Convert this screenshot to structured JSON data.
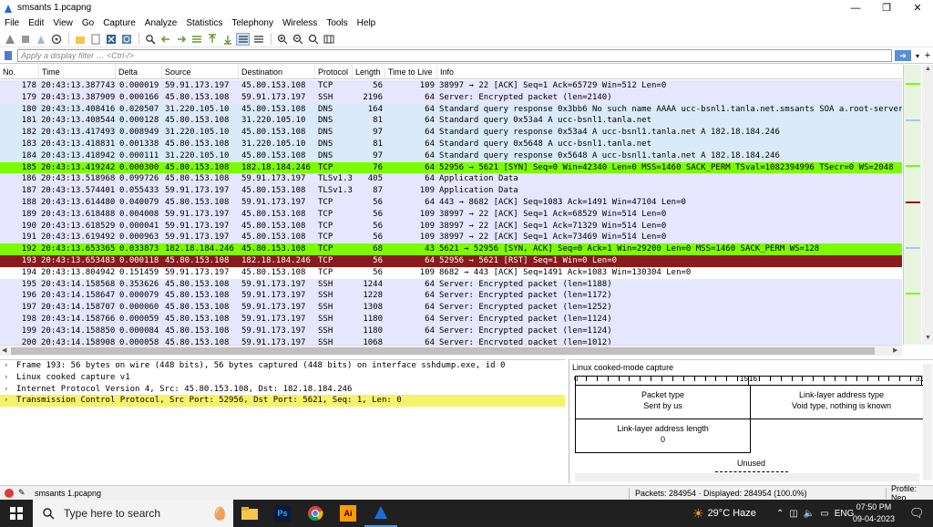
{
  "window": {
    "title": "smsants 1.pcapng",
    "minimize": "—",
    "maximize": "❐",
    "close": "✕"
  },
  "menu": [
    "File",
    "Edit",
    "View",
    "Go",
    "Capture",
    "Analyze",
    "Statistics",
    "Telephony",
    "Wireless",
    "Tools",
    "Help"
  ],
  "filter": {
    "placeholder": "Apply a display filter … <Ctrl-/>",
    "apply_icon": "arrow-right-icon"
  },
  "columns": [
    "No.",
    "Time",
    "Delta",
    "Source",
    "Destination",
    "Protocol",
    "Length",
    "Time to Live",
    "Info"
  ],
  "packets": [
    {
      "no": "178",
      "time": "20:43:13.387743",
      "delta": "0.000019",
      "src": "59.91.173.197",
      "dst": "45.80.153.108",
      "proto": "TCP",
      "len": "56",
      "ttl": "109",
      "info": "38997 → 22 [ACK] Seq=1 Ack=65729 Win=512 Len=0",
      "style": "blue"
    },
    {
      "no": "179",
      "time": "20:43:13.387909",
      "delta": "0.000166",
      "src": "45.80.153.108",
      "dst": "59.91.173.197",
      "proto": "SSH",
      "len": "2196",
      "ttl": "64",
      "info": "Server: Encrypted packet (len=2140)",
      "style": "blue"
    },
    {
      "no": "180",
      "time": "20:43:13.408416",
      "delta": "0.020507",
      "src": "31.220.105.10",
      "dst": "45.80.153.108",
      "proto": "DNS",
      "len": "164",
      "ttl": "64",
      "info": "Standard query response 0x3bb6 No such name AAAA ucc-bsnl1.tanla.net.smsants SOA a.root-servers.",
      "style": "lblue"
    },
    {
      "no": "181",
      "time": "20:43:13.408544",
      "delta": "0.000128",
      "src": "45.80.153.108",
      "dst": "31.220.105.10",
      "proto": "DNS",
      "len": "81",
      "ttl": "64",
      "info": "Standard query 0x53a4 A ucc-bsnl1.tanla.net",
      "style": "lblue"
    },
    {
      "no": "182",
      "time": "20:43:13.417493",
      "delta": "0.008949",
      "src": "31.220.105.10",
      "dst": "45.80.153.108",
      "proto": "DNS",
      "len": "97",
      "ttl": "64",
      "info": "Standard query response 0x53a4 A ucc-bsnl1.tanla.net A 182.18.184.246",
      "style": "lblue"
    },
    {
      "no": "183",
      "time": "20:43:13.418831",
      "delta": "0.001338",
      "src": "45.80.153.108",
      "dst": "31.220.105.10",
      "proto": "DNS",
      "len": "81",
      "ttl": "64",
      "info": "Standard query 0x5648 A ucc-bsnl1.tanla.net",
      "style": "lblue"
    },
    {
      "no": "184",
      "time": "20:43:13.418942",
      "delta": "0.000111",
      "src": "31.220.105.10",
      "dst": "45.80.153.108",
      "proto": "DNS",
      "len": "97",
      "ttl": "64",
      "info": "Standard query response 0x5648 A ucc-bsnl1.tanla.net A 182.18.184.246",
      "style": "lblue"
    },
    {
      "no": "185",
      "time": "20:43:13.419242",
      "delta": "0.000300",
      "src": "45.80.153.108",
      "dst": "182.18.184.246",
      "proto": "TCP",
      "len": "76",
      "ttl": "64",
      "info": "52956 → 5621 [SYN] Seq=0 Win=42340 Len=0 MSS=1460 SACK_PERM TSval=1082394996 TSecr=0 WS=2048",
      "style": "green"
    },
    {
      "no": "186",
      "time": "20:43:13.518968",
      "delta": "0.099726",
      "src": "45.80.153.108",
      "dst": "59.91.173.197",
      "proto": "TLSv1.3",
      "len": "405",
      "ttl": "64",
      "info": "Application Data",
      "style": "blue"
    },
    {
      "no": "187",
      "time": "20:43:13.574401",
      "delta": "0.055433",
      "src": "59.91.173.197",
      "dst": "45.80.153.108",
      "proto": "TLSv1.3",
      "len": "87",
      "ttl": "109",
      "info": "Application Data",
      "style": "blue"
    },
    {
      "no": "188",
      "time": "20:43:13.614480",
      "delta": "0.040079",
      "src": "45.80.153.108",
      "dst": "59.91.173.197",
      "proto": "TCP",
      "len": "56",
      "ttl": "64",
      "info": "443 → 8682 [ACK] Seq=1083 Ack=1491 Win=47104 Len=0",
      "style": "blue"
    },
    {
      "no": "189",
      "time": "20:43:13.618488",
      "delta": "0.004008",
      "src": "59.91.173.197",
      "dst": "45.80.153.108",
      "proto": "TCP",
      "len": "56",
      "ttl": "109",
      "info": "38997 → 22 [ACK] Seq=1 Ack=68529 Win=514 Len=0",
      "style": "blue"
    },
    {
      "no": "190",
      "time": "20:43:13.618529",
      "delta": "0.000041",
      "src": "59.91.173.197",
      "dst": "45.80.153.108",
      "proto": "TCP",
      "len": "56",
      "ttl": "109",
      "info": "38997 → 22 [ACK] Seq=1 Ack=71329 Win=514 Len=0",
      "style": "blue"
    },
    {
      "no": "191",
      "time": "20:43:13.619492",
      "delta": "0.000963",
      "src": "59.91.173.197",
      "dst": "45.80.153.108",
      "proto": "TCP",
      "len": "56",
      "ttl": "109",
      "info": "38997 → 22 [ACK] Seq=1 Ack=73469 Win=514 Len=0",
      "style": "blue"
    },
    {
      "no": "192",
      "time": "20:43:13.653365",
      "delta": "0.033873",
      "src": "182.18.184.246",
      "dst": "45.80.153.108",
      "proto": "TCP",
      "len": "68",
      "ttl": "43",
      "info": "5621 → 52956 [SYN, ACK] Seq=0 Ack=1 Win=29200 Len=0 MSS=1460 SACK_PERM WS=128",
      "style": "green"
    },
    {
      "no": "193",
      "time": "20:43:13.653483",
      "delta": "0.000118",
      "src": "45.80.153.108",
      "dst": "182.18.184.246",
      "proto": "TCP",
      "len": "56",
      "ttl": "64",
      "info": "52956 → 5621 [RST] Seq=1 Win=0 Len=0",
      "style": "sel"
    },
    {
      "no": "194",
      "time": "20:43:13.804942",
      "delta": "0.151459",
      "src": "59.91.173.197",
      "dst": "45.80.153.108",
      "proto": "TCP",
      "len": "56",
      "ttl": "109",
      "info": "8682 → 443 [ACK] Seq=1491 Ack=1083 Win=130304 Len=0",
      "style": "white"
    },
    {
      "no": "195",
      "time": "20:43:14.158568",
      "delta": "0.353626",
      "src": "45.80.153.108",
      "dst": "59.91.173.197",
      "proto": "SSH",
      "len": "1244",
      "ttl": "64",
      "info": "Server: Encrypted packet (len=1188)",
      "style": "blue"
    },
    {
      "no": "196",
      "time": "20:43:14.158647",
      "delta": "0.000079",
      "src": "45.80.153.108",
      "dst": "59.91.173.197",
      "proto": "SSH",
      "len": "1228",
      "ttl": "64",
      "info": "Server: Encrypted packet (len=1172)",
      "style": "blue"
    },
    {
      "no": "197",
      "time": "20:43:14.158707",
      "delta": "0.000060",
      "src": "45.80.153.108",
      "dst": "59.91.173.197",
      "proto": "SSH",
      "len": "1308",
      "ttl": "64",
      "info": "Server: Encrypted packet (len=1252)",
      "style": "blue"
    },
    {
      "no": "198",
      "time": "20:43:14.158766",
      "delta": "0.000059",
      "src": "45.80.153.108",
      "dst": "59.91.173.197",
      "proto": "SSH",
      "len": "1180",
      "ttl": "64",
      "info": "Server: Encrypted packet (len=1124)",
      "style": "blue"
    },
    {
      "no": "199",
      "time": "20:43:14.158850",
      "delta": "0.000084",
      "src": "45.80.153.108",
      "dst": "59.91.173.197",
      "proto": "SSH",
      "len": "1180",
      "ttl": "64",
      "info": "Server: Encrypted packet (len=1124)",
      "style": "blue"
    },
    {
      "no": "200",
      "time": "20:43:14.158908",
      "delta": "0.000058",
      "src": "45.80.153.108",
      "dst": "59.91.173.197",
      "proto": "SSH",
      "len": "1068",
      "ttl": "64",
      "info": "Server: Encrypted packet (len=1012)",
      "style": "blue"
    }
  ],
  "details": [
    {
      "text": "Frame 193: 56 bytes on wire (448 bits), 56 bytes captured (448 bits) on interface sshdump.exe, id 0",
      "hl": false
    },
    {
      "text": "Linux cooked capture v1",
      "hl": false
    },
    {
      "text": "Internet Protocol Version 4, Src: 45.80.153.108, Dst: 182.18.184.246",
      "hl": false
    },
    {
      "text": "Transmission Control Protocol, Src Port: 52956, Dst Port: 5621, Seq: 1, Len: 0",
      "hl": true
    }
  ],
  "diagram": {
    "title": "Linux cooked-mode capture",
    "ruler_0": "0",
    "ruler_15": "15",
    "ruler_16": "16",
    "ruler_31": "31",
    "packet_type": "Packet type",
    "packet_type_val": "Sent by us",
    "lla_type": "Link-layer address type",
    "lla_type_val": "Void type, nothing is known",
    "lla_len": "Link-layer address length",
    "lla_len_val": "0",
    "unused": "Unused"
  },
  "status": {
    "file": "smsants 1.pcapng",
    "packets": "Packets: 284954 · Displayed: 284954 (100.0%)",
    "profile": "Profile: Neo"
  },
  "taskbar": {
    "search_placeholder": "Type here to search",
    "apps": [
      "file-explorer-icon",
      "photoshop-icon",
      "chrome-icon",
      "illustrator-icon",
      "wireshark-icon"
    ],
    "ps_label": "Ps",
    "ai_label": "Ai",
    "weather_temp": "29°C",
    "weather_desc": "Haze",
    "lang": "ENG",
    "time": "07:50 PM",
    "date": "09-04-2023"
  },
  "colors": {
    "accent": "#4a7fd0",
    "selected_row": "#8b1a1a",
    "syn_row": "#7cfc00",
    "tcp_row": "#e7e6ff",
    "dns_row": "#dbeaf8",
    "detail_highlight": "#f4f46a"
  }
}
